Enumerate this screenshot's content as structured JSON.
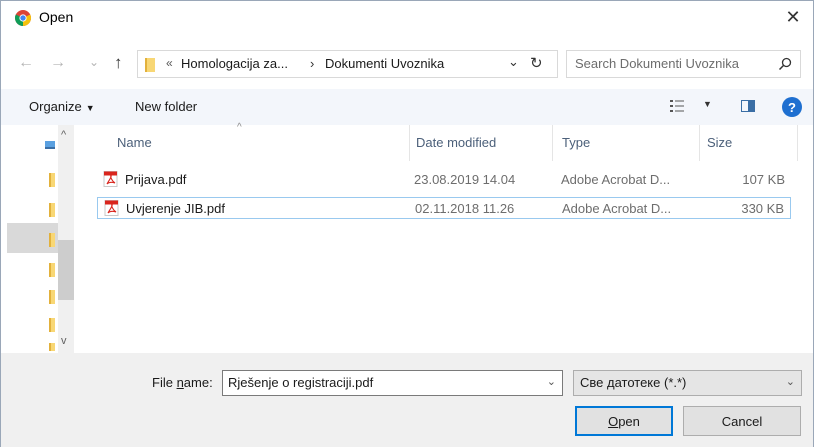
{
  "window": {
    "title": "Open",
    "close_glyph": "✕",
    "icon": "chrome-icon"
  },
  "navigation": {
    "back_glyph": "←",
    "forward_glyph": "→",
    "recent_glyph": "⌄",
    "up_glyph": "↑",
    "address": {
      "overflow_glyph": "«",
      "crumbs": [
        "Homologacija za...",
        "Dokumenti Uvoznika"
      ],
      "separator": "›",
      "dropdown_glyph": "⌄",
      "refresh_glyph": "↻"
    },
    "search": {
      "placeholder": "Search Dokumenti Uvoznika"
    }
  },
  "toolbar": {
    "organize_label": "Organize",
    "organize_caret": "▼",
    "new_folder_label": "New folder",
    "view_caret": "▼",
    "help_label": "?"
  },
  "columns": {
    "name": "Name",
    "date_modified": "Date modified",
    "type": "Type",
    "size": "Size",
    "sort_indicator": "^"
  },
  "files": [
    {
      "name": "Prijava.pdf",
      "date": "23.08.2019 14.04",
      "type": "Adobe Acrobat D...",
      "size": "107 KB",
      "selected": false
    },
    {
      "name": "Uvjerenje JIB.pdf",
      "date": "02.11.2018 11.26",
      "type": "Adobe Acrobat D...",
      "size": "330 KB",
      "selected": true
    }
  ],
  "bottom": {
    "file_name_label_pre": "File ",
    "file_name_label_ul": "n",
    "file_name_label_post": "ame:",
    "file_name_value": "Rješenje o registraciji.pdf",
    "file_type_value": "Све датотеке (*.*)",
    "dropdown_glyph": "⌄",
    "open_label_ul": "O",
    "open_label_rest": "pen",
    "cancel_label": "Cancel"
  },
  "scrollbar": {
    "up_glyph": "^",
    "down_glyph": "v"
  },
  "colors": {
    "accent": "#0078d7",
    "toolbar_bg": "#f3f6fb",
    "header_text": "#4c607a",
    "folder": "#f8d775",
    "pdf_red": "#d9251d"
  }
}
